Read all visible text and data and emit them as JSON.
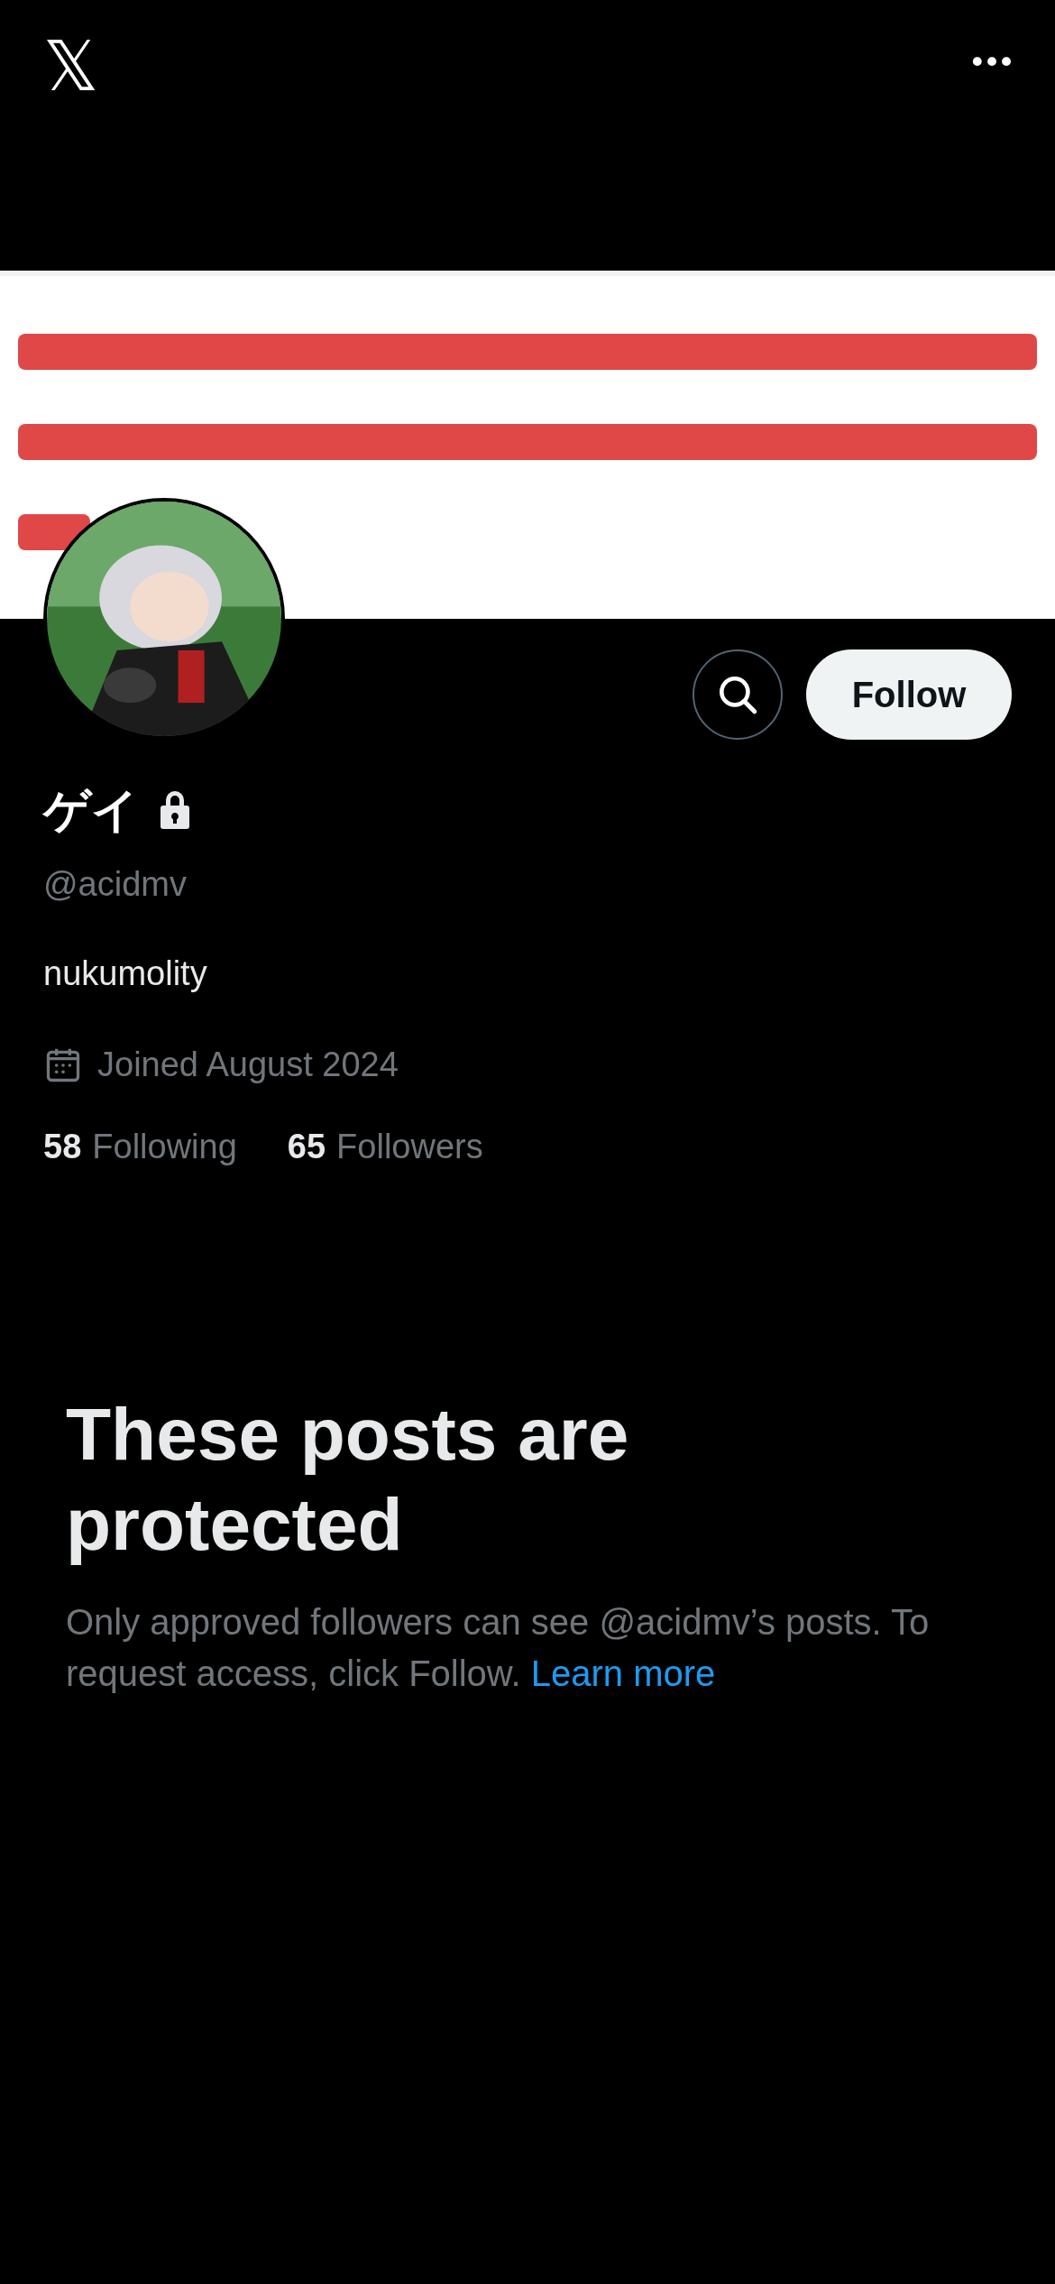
{
  "top_bar": {
    "logo": "𝕏",
    "menu": "•••"
  },
  "actions": {
    "follow": "Follow"
  },
  "profile": {
    "name": "ゲイ",
    "protected": true,
    "handle": "@acidmv",
    "bio": "nukumolity",
    "joined": "Joined August 2024",
    "stats": [
      {
        "count": "58",
        "label": "Following"
      },
      {
        "count": "65",
        "label": "Followers"
      }
    ]
  },
  "protected_notice": {
    "title": "These posts are protected",
    "text": "Only approved followers can see @acidmv’s posts. To request access, click Follow.",
    "link": "Learn more"
  }
}
